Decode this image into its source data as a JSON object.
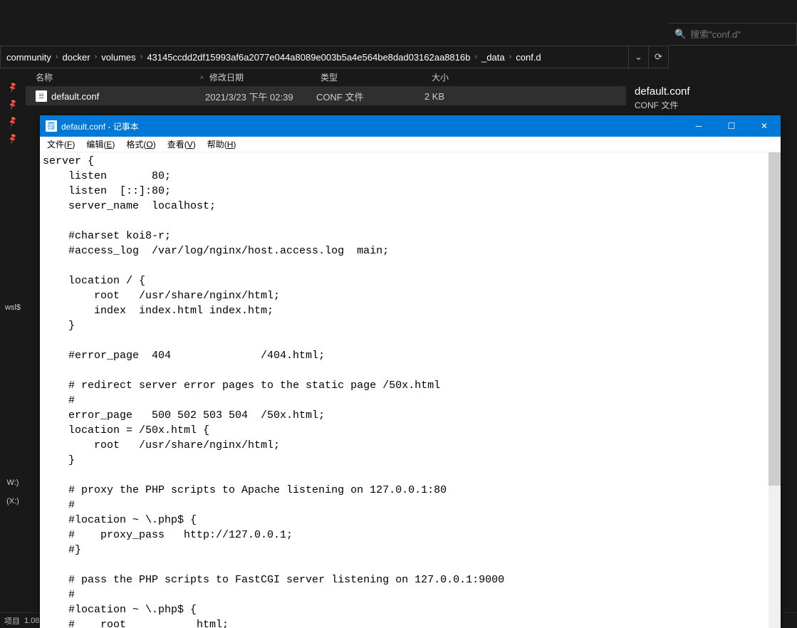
{
  "breadcrumb": {
    "items": [
      "community",
      "docker",
      "volumes",
      "43145ccdd2df15993af6a2077e044a8089e003b5a4e564be8dad03162aa8816b",
      "_data",
      "conf.d"
    ]
  },
  "search": {
    "placeholder": "搜索\"conf.d\""
  },
  "columns": {
    "name": "名称",
    "date": "修改日期",
    "type": "类型",
    "size": "大小"
  },
  "file_list": {
    "rows": [
      {
        "name": "default.conf",
        "date": "2021/3/23 下午 02:39",
        "type": "CONF 文件",
        "size": "2 KB"
      }
    ]
  },
  "details": {
    "title": "default.conf",
    "subtitle": "CONF 文件"
  },
  "left_rail": {
    "item0": "wsl$",
    "item1": "W:)",
    "item2": "(X:)"
  },
  "statusbar": {
    "left0": "项目",
    "left1": "1.08"
  },
  "notepad": {
    "title": "default.conf - 记事本",
    "menu": {
      "file": "文件(F)",
      "edit": "编辑(E)",
      "format": "格式(O)",
      "view": "查看(V)",
      "help": "帮助(H)"
    },
    "content": "server {\n    listen       80;\n    listen  [::]:80;\n    server_name  localhost;\n\n    #charset koi8-r;\n    #access_log  /var/log/nginx/host.access.log  main;\n\n    location / {\n        root   /usr/share/nginx/html;\n        index  index.html index.htm;\n    }\n\n    #error_page  404              /404.html;\n\n    # redirect server error pages to the static page /50x.html\n    #\n    error_page   500 502 503 504  /50x.html;\n    location = /50x.html {\n        root   /usr/share/nginx/html;\n    }\n\n    # proxy the PHP scripts to Apache listening on 127.0.0.1:80\n    #\n    #location ~ \\.php$ {\n    #    proxy_pass   http://127.0.0.1;\n    #}\n\n    # pass the PHP scripts to FastCGI server listening on 127.0.0.1:9000\n    #\n    #location ~ \\.php$ {\n    #    root           html;"
  }
}
